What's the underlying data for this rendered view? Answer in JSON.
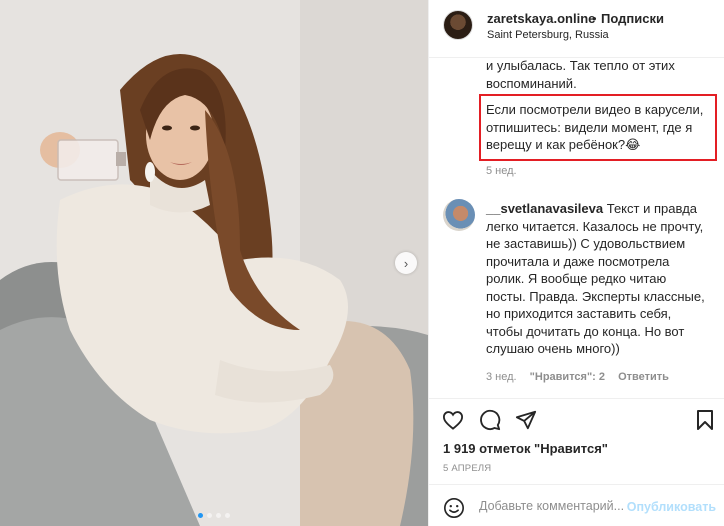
{
  "post": {
    "username": "zaretskaya.online",
    "separator": "•",
    "follow_label": "Подписки",
    "location": "Saint Petersburg, Russia"
  },
  "caption": {
    "tail_text": "и улыбалась. Так тепло от этих воспоминаний.",
    "highlighted_text": "Если посмотрели видео в карусели, отпишитесь: видели момент, где я верещу и как ребёнок?😂",
    "age": "5 нед."
  },
  "comment": {
    "username": "__svetlanavasileva",
    "text": "Текст и правда легко читается. Казалось не прочту, не заставишь)) С удовольствием прочитала и даже посмотрела ролик. Я вообще редко читаю посты. Правда. Эксперты классные, но приходится заставить себя, чтобы дочитать до конца. Но вот слушаю очень много))",
    "age": "3 нед.",
    "likes": "\"Нравится\": 2",
    "reply_label": "Ответить"
  },
  "actions": {
    "like_icon": "heart-icon",
    "comment_icon": "comment-bubble-icon",
    "share_icon": "paper-plane-icon",
    "save_icon": "bookmark-icon"
  },
  "likes_text": "1 919 отметок \"Нравится\"",
  "date_text": "5 АПРЕЛЯ",
  "composer": {
    "emoji_icon": "smiley-icon",
    "placeholder": "Добавьте комментарий...",
    "publish_label": "Опубликовать"
  },
  "carousel": {
    "next_arrow": "›",
    "dot_count": 4,
    "active_index": 0
  },
  "colors": {
    "highlight_border": "#e31e24",
    "carousel_active_dot": "#2196f3",
    "publish_disabled": "#b2dffc"
  }
}
